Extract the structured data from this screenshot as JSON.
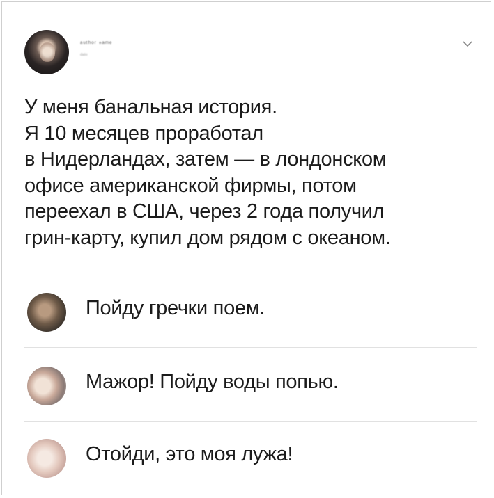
{
  "post": {
    "author_name": "ᵃᵘᵗʰᵒʳ ⁿᵃᵐᵉ",
    "author_meta": "ᵈᵃᵗᵉ",
    "lines": [
      "У меня банальная история.",
      "Я 10 месяцев проработал",
      "в Нидерландах, затем — в лондонском",
      "офисе американской фирмы, потом",
      "переехал в США, через 2 года получил",
      "грин-карту, купил дом рядом с океаном."
    ],
    "menu_icon": "chevron-down-icon"
  },
  "comments": [
    {
      "text": "Пойду гречки поем."
    },
    {
      "text": "Мажор! Пойду воды попью."
    },
    {
      "text": "Отойди, это моя лужа!"
    }
  ],
  "colors": {
    "text": "#1b1b1b",
    "divider": "#e1e1e1",
    "chevron": "#8a8a8a"
  }
}
